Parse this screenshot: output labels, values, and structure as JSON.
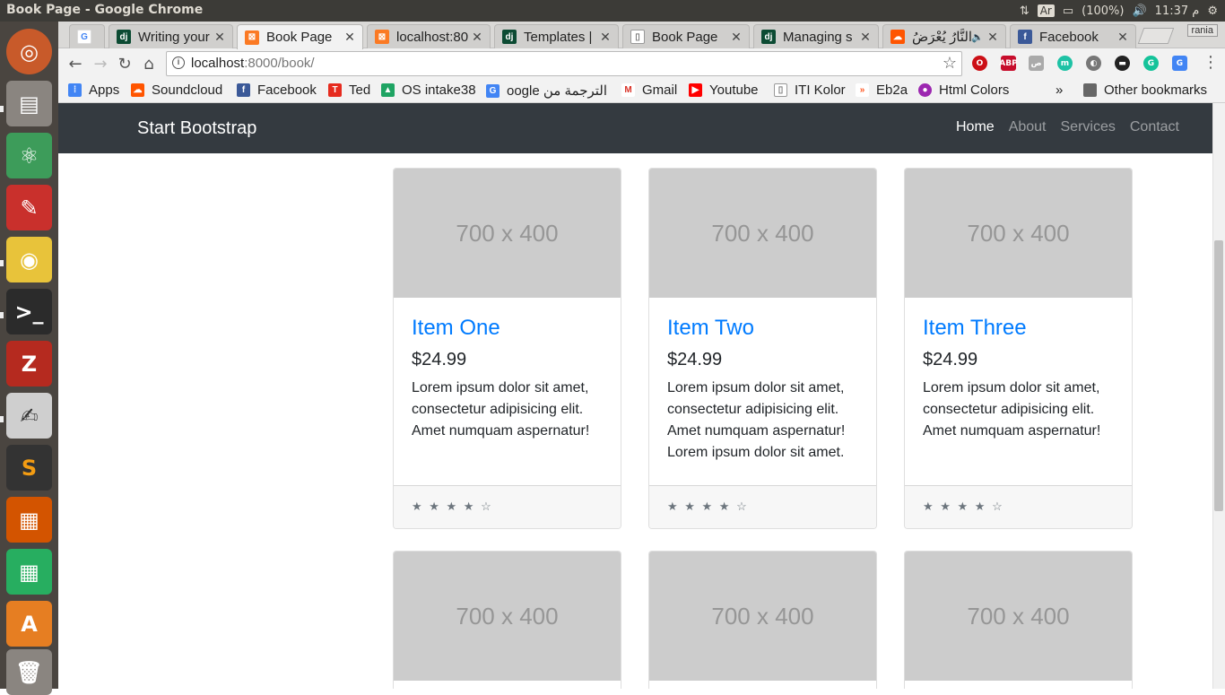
{
  "window": {
    "title": "Book Page - Google Chrome"
  },
  "tray": {
    "keyboard": "Ar",
    "battery": "(100%)",
    "clock": "11:37 م"
  },
  "tabs": [
    {
      "label": "",
      "icon": "google-icon"
    },
    {
      "label": "Writing your",
      "icon": "django-icon"
    },
    {
      "label": "Book Page",
      "icon": "xampp-icon"
    },
    {
      "label": "localhost:80",
      "icon": "xampp-icon"
    },
    {
      "label": "Templates |",
      "icon": "django-icon"
    },
    {
      "label": "Book Page",
      "icon": "page-icon"
    },
    {
      "label": "Managing s",
      "icon": "django-icon"
    },
    {
      "label": "النَّارُ يُعْرَضُ",
      "icon": "soundcloud-icon"
    },
    {
      "label": "Facebook",
      "icon": "facebook-icon"
    }
  ],
  "profile": "rania",
  "address": {
    "host": "localhost",
    "path": ":8000/book/"
  },
  "bookmarks": [
    {
      "label": "Apps",
      "icon": "apps-icon",
      "color": "#4285f4"
    },
    {
      "label": "Soundcloud",
      "icon": "soundcloud-icon",
      "color": "#ff5500"
    },
    {
      "label": "Facebook",
      "icon": "facebook-icon",
      "color": "#3b5998"
    },
    {
      "label": "Ted",
      "icon": "ted-icon",
      "color": "#e62b1e"
    },
    {
      "label": "OS intake38",
      "icon": "drive-icon",
      "color": "#1fa463"
    },
    {
      "label": "oogle الترجمة من",
      "icon": "translate-icon",
      "color": "#4285f4"
    },
    {
      "label": "Gmail",
      "icon": "gmail-icon",
      "color": "#d93025"
    },
    {
      "label": "Youtube",
      "icon": "youtube-icon",
      "color": "#ff0000"
    },
    {
      "label": "ITI Kolor",
      "icon": "page-icon",
      "color": "#777777"
    },
    {
      "label": "Eb2a",
      "icon": "eb2a-icon",
      "color": "#ff5722"
    },
    {
      "label": "Html Colors",
      "icon": "colors-icon",
      "color": "#9c27b0"
    }
  ],
  "other_bookmarks": "Other bookmarks",
  "site": {
    "brand": "Start Bootstrap",
    "nav": [
      "Home",
      "About",
      "Services",
      "Contact"
    ]
  },
  "placeholder": "700 x 400",
  "cards": [
    {
      "title": "Item One",
      "price": "$24.99",
      "text": "Lorem ipsum dolor sit amet, consectetur adipisicing elit. Amet numquam aspernatur!",
      "stars": "★ ★ ★ ★ ☆",
      "rating": 4
    },
    {
      "title": "Item Two",
      "price": "$24.99",
      "text": "Lorem ipsum dolor sit amet, consectetur adipisicing elit. Amet numquam aspernatur! Lorem ipsum dolor sit amet.",
      "stars": "★ ★ ★ ★ ☆",
      "rating": 4
    },
    {
      "title": "Item Three",
      "price": "$24.99",
      "text": "Lorem ipsum dolor sit amet, consectetur adipisicing elit. Amet numquam aspernatur!",
      "stars": "★ ★ ★ ★ ☆",
      "rating": 4
    }
  ],
  "colors": {
    "navbar": "#343a40",
    "link": "#007bff",
    "placeholder_bg": "#cccccc"
  }
}
